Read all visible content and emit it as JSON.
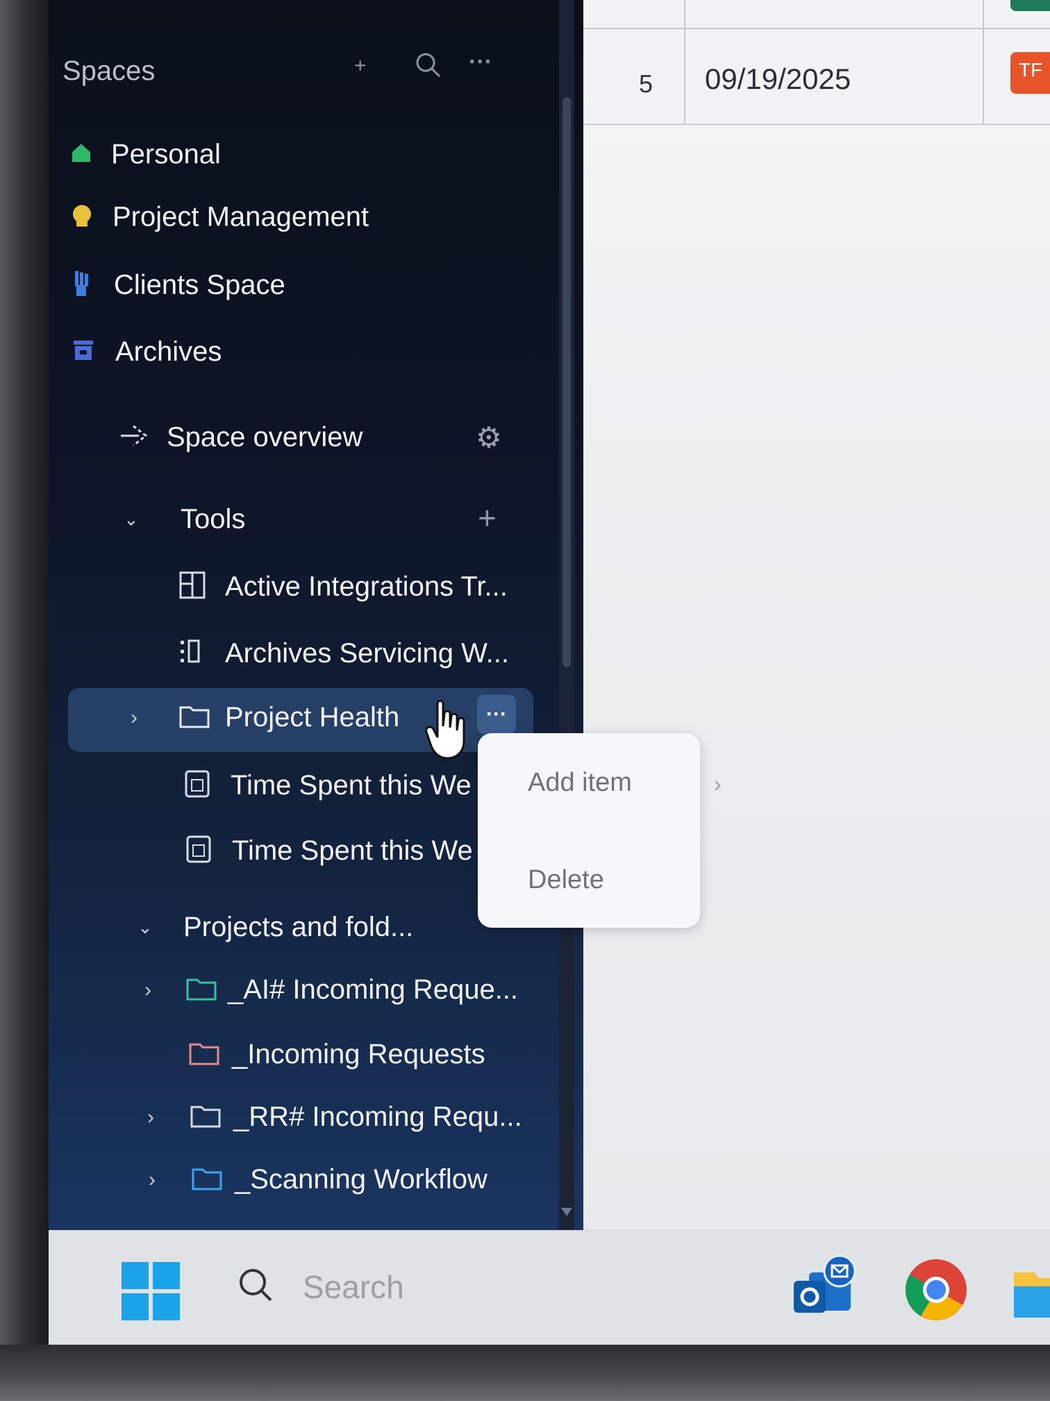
{
  "sidebar": {
    "title": "Spaces",
    "header_icons": [
      "plus-icon",
      "search-icon",
      "more-icon"
    ],
    "spaces": [
      {
        "label": "Personal",
        "icon": "house-icon",
        "color": "#2fb86a"
      },
      {
        "label": "Project Management",
        "icon": "brain-icon",
        "color": "#e7c23a"
      },
      {
        "label": "Clients Space",
        "icon": "hand-icon",
        "color": "#3f7fe0"
      },
      {
        "label": "Archives",
        "icon": "archive-box-icon",
        "color": "#4b6bd8"
      }
    ],
    "space_overview": "Space overview",
    "tools_label": "Tools",
    "tools": [
      {
        "label": "Active Integrations Tr...",
        "icon": "board-icon"
      },
      {
        "label": "Archives Servicing W...",
        "icon": "list-icon"
      },
      {
        "label": "Project Health",
        "icon": "folder-icon"
      },
      {
        "label": "Time Spent this We",
        "icon": "report-icon"
      },
      {
        "label": "Time Spent this We",
        "icon": "report-icon"
      }
    ],
    "projects_label": "Projects and fold...",
    "projects": [
      {
        "label": "_AI# Incoming Reque...",
        "icon": "folder-icon",
        "color": "#2fc7a3"
      },
      {
        "label": "_Incoming Requests",
        "icon": "folder-icon",
        "color": "#e88a8a"
      },
      {
        "label": "_RR# Incoming Requ...",
        "icon": "folder-icon",
        "color": "#d7d9de"
      },
      {
        "label": "_Scanning Workflow",
        "icon": "folder-icon",
        "color": "#3aa6f0"
      }
    ]
  },
  "context_menu": {
    "items": [
      "Add item",
      "Delete"
    ]
  },
  "table": {
    "row_number": "5",
    "date": "09/19/2025",
    "badge": "TF"
  },
  "taskbar": {
    "search_placeholder": "Search",
    "apps": [
      "outlook-icon",
      "chrome-icon",
      "file-explorer-icon"
    ]
  }
}
